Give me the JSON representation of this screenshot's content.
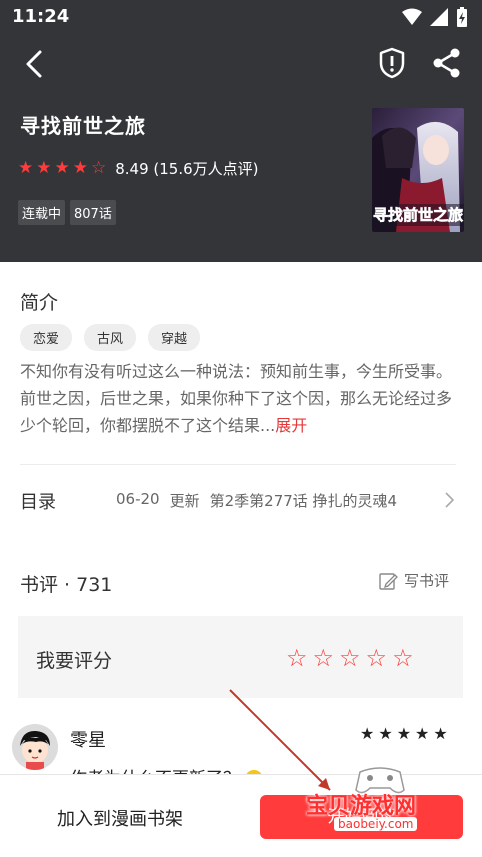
{
  "status_bar": {
    "time": "11:24"
  },
  "book": {
    "title": "寻找前世之旅",
    "rating_stars": 4.5,
    "rating_text": "8.49 (15.6万人点评)",
    "status": "连载中",
    "chapters": "807话",
    "cover_title": "寻找前世之旅"
  },
  "intro": {
    "title": "简介",
    "tags": [
      "恋爱",
      "古风",
      "穿越"
    ],
    "description": "不知你有没有听过这么一种说法：预知前生事，今生所受事。前世之因，后世之果，如果你种下了这个因，那么无论经过多少个轮回，你都摆脱不了这个结果...",
    "expand": "展开"
  },
  "toc": {
    "label": "目录",
    "date": "06-20",
    "status": "更新",
    "latest": "第2季第277话 挣扎的灵魂4"
  },
  "reviews": {
    "count_label": "书评 · 731",
    "write_label": "写书评",
    "rate_label": "我要评分",
    "comment": {
      "username": "零星",
      "stars": 5,
      "text": "作者为什么不更新了？"
    }
  },
  "bottom": {
    "add_shelf": "加入到漫画书架",
    "read": "开始阅读"
  },
  "watermark": {
    "text": "宝贝游戏网",
    "url": "baobeiy.com"
  },
  "colors": {
    "header_bg": "#333538",
    "accent": "#ff3b3b"
  }
}
